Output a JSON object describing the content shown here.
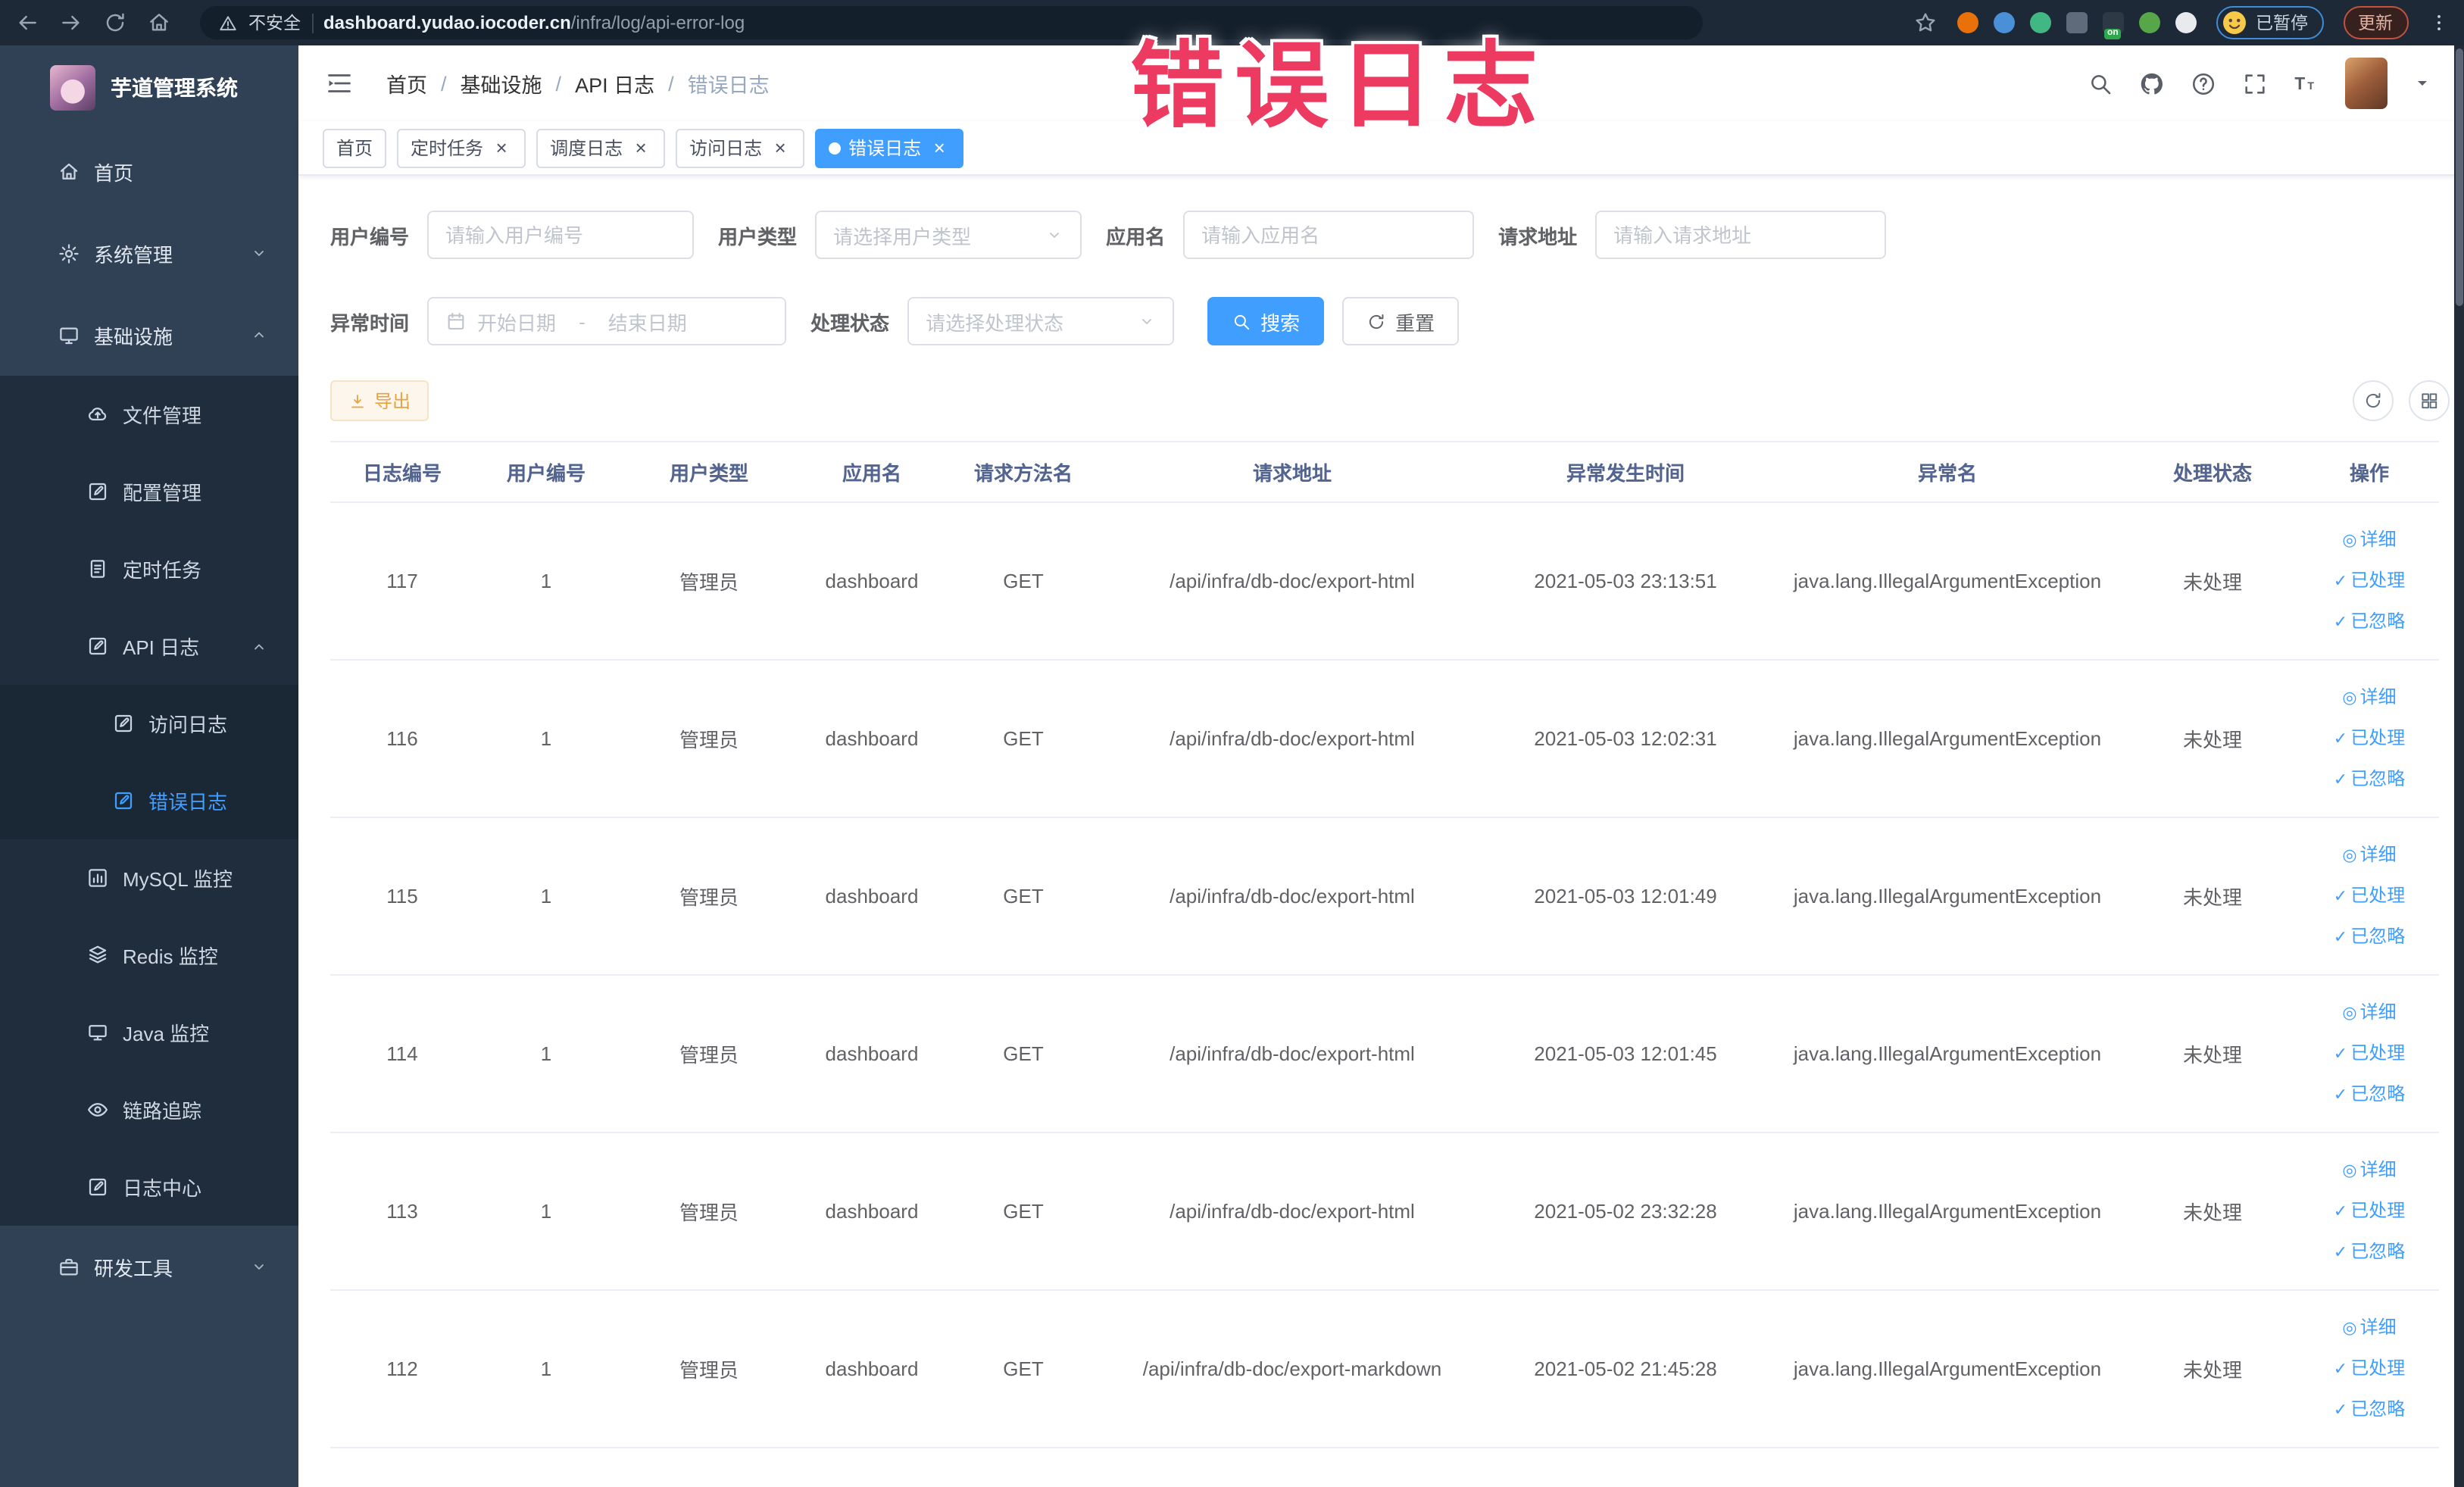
{
  "theme": {
    "accent": "#409eff",
    "warning": "#e6a23c",
    "overlay_color": "#ec3a60",
    "sidebar_bg": "#304156",
    "submenu_bg": "#1f2d3d"
  },
  "overlay": {
    "text": "错误日志"
  },
  "browser": {
    "security_label": "不安全",
    "url_host": "dashboard.yudao.iocoder.cn",
    "url_path": "/infra/log/api-error-log",
    "paused_label": "已暂停",
    "update_label": "更新",
    "extensions": [
      {
        "name": "orange-extension-icon",
        "color": "#e8710a",
        "shape": "circle"
      },
      {
        "name": "blue-shield-extension-icon",
        "color": "#4a90d9",
        "shape": "circle"
      },
      {
        "name": "green-v-extension-icon",
        "color": "#41b883",
        "shape": "circle"
      },
      {
        "name": "grid-extension-icon",
        "color": "#5f6b7a",
        "shape": "square"
      },
      {
        "name": "switch-on-extension-icon",
        "color": "#2d3a46",
        "shape": "square",
        "badge": "on"
      },
      {
        "name": "green-leaf-extension-icon",
        "color": "#57a64a",
        "shape": "circle"
      },
      {
        "name": "puzzle-extension-icon",
        "color": "#e8eaed",
        "shape": "circle"
      }
    ]
  },
  "sidebar": {
    "app_title": "芋道管理系统",
    "items": [
      {
        "label": "首页",
        "icon": "home-icon",
        "level": 1
      },
      {
        "label": "系统管理",
        "icon": "gear-icon",
        "level": 1,
        "chevron": "down"
      },
      {
        "label": "基础设施",
        "icon": "monitor-icon",
        "level": 1,
        "chevron": "up"
      },
      {
        "label": "文件管理",
        "icon": "cloud-upload-icon",
        "level": 2
      },
      {
        "label": "配置管理",
        "icon": "edit-square-icon",
        "level": 2
      },
      {
        "label": "定时任务",
        "icon": "document-icon",
        "level": 2
      },
      {
        "label": "API 日志",
        "icon": "edit-square-icon",
        "level": 2,
        "chevron": "up"
      },
      {
        "label": "访问日志",
        "icon": "edit-square-icon",
        "level": 3
      },
      {
        "label": "错误日志",
        "icon": "edit-square-icon",
        "level": 3,
        "active": true
      },
      {
        "label": "MySQL 监控",
        "icon": "chart-icon",
        "level": 2
      },
      {
        "label": "Redis 监控",
        "icon": "layers-icon",
        "level": 2
      },
      {
        "label": "Java 监控",
        "icon": "display-icon",
        "level": 2
      },
      {
        "label": "链路追踪",
        "icon": "eye-icon",
        "level": 2
      },
      {
        "label": "日志中心",
        "icon": "edit-square-icon",
        "level": 2
      },
      {
        "label": "研发工具",
        "icon": "briefcase-icon",
        "level": 1,
        "chevron": "down"
      }
    ]
  },
  "breadcrumb": [
    "首页",
    "基础设施",
    "API 日志",
    "错误日志"
  ],
  "tabs": [
    {
      "label": "首页",
      "closable": false,
      "active": false
    },
    {
      "label": "定时任务",
      "closable": true,
      "active": false
    },
    {
      "label": "调度日志",
      "closable": true,
      "active": false
    },
    {
      "label": "访问日志",
      "closable": true,
      "active": false
    },
    {
      "label": "错误日志",
      "closable": true,
      "active": true
    }
  ],
  "filters": {
    "user_id_label": "用户编号",
    "user_id_placeholder": "请输入用户编号",
    "user_type_label": "用户类型",
    "user_type_placeholder": "请选择用户类型",
    "app_name_label": "应用名",
    "app_name_placeholder": "请输入应用名",
    "request_url_label": "请求地址",
    "request_url_placeholder": "请输入请求地址",
    "exception_time_label": "异常时间",
    "date_start_placeholder": "开始日期",
    "date_separator": "-",
    "date_end_placeholder": "结束日期",
    "process_status_label": "处理状态",
    "process_status_placeholder": "请选择处理状态",
    "search_label": "搜索",
    "reset_label": "重置"
  },
  "toolbar": {
    "export_label": "导出"
  },
  "table": {
    "columns": [
      "日志编号",
      "用户编号",
      "用户类型",
      "应用名",
      "请求方法名",
      "请求地址",
      "异常发生时间",
      "异常名",
      "处理状态",
      "操作"
    ],
    "action_labels": {
      "detail": "详细",
      "processed": "已处理",
      "ignored": "已忽略"
    },
    "rows": [
      {
        "id": "117",
        "user_id": "1",
        "user_type": "管理员",
        "app_name": "dashboard",
        "method": "GET",
        "url": "/api/infra/db-doc/export-html",
        "time": "2021-05-03 23:13:51",
        "exception": "java.lang.IllegalArgumentException",
        "status": "未处理"
      },
      {
        "id": "116",
        "user_id": "1",
        "user_type": "管理员",
        "app_name": "dashboard",
        "method": "GET",
        "url": "/api/infra/db-doc/export-html",
        "time": "2021-05-03 12:02:31",
        "exception": "java.lang.IllegalArgumentException",
        "status": "未处理"
      },
      {
        "id": "115",
        "user_id": "1",
        "user_type": "管理员",
        "app_name": "dashboard",
        "method": "GET",
        "url": "/api/infra/db-doc/export-html",
        "time": "2021-05-03 12:01:49",
        "exception": "java.lang.IllegalArgumentException",
        "status": "未处理"
      },
      {
        "id": "114",
        "user_id": "1",
        "user_type": "管理员",
        "app_name": "dashboard",
        "method": "GET",
        "url": "/api/infra/db-doc/export-html",
        "time": "2021-05-03 12:01:45",
        "exception": "java.lang.IllegalArgumentException",
        "status": "未处理"
      },
      {
        "id": "113",
        "user_id": "1",
        "user_type": "管理员",
        "app_name": "dashboard",
        "method": "GET",
        "url": "/api/infra/db-doc/export-html",
        "time": "2021-05-02 23:32:28",
        "exception": "java.lang.IllegalArgumentException",
        "status": "未处理"
      },
      {
        "id": "112",
        "user_id": "1",
        "user_type": "管理员",
        "app_name": "dashboard",
        "method": "GET",
        "url": "/api/infra/db-doc/export-markdown",
        "time": "2021-05-02 21:45:28",
        "exception": "java.lang.IllegalArgumentException",
        "status": "未处理"
      }
    ]
  }
}
